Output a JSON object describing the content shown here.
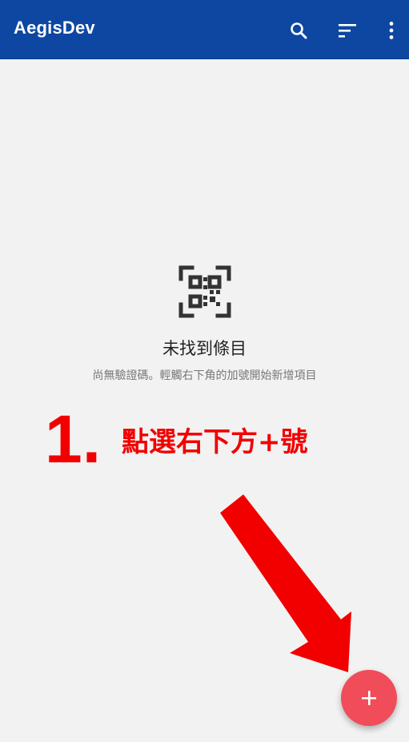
{
  "appbar": {
    "title": "AegisDev",
    "icons": [
      "search-icon",
      "sort-icon",
      "more-vertical-icon"
    ],
    "background": "#0d47a1"
  },
  "empty_state": {
    "icon": "qr-code-icon",
    "title": "未找到條目",
    "description": "尚無驗證碼。輕觸右下角的加號開始新增項目"
  },
  "annotation": {
    "step_number": "1.",
    "instruction": "點選右下方+號",
    "color": "#f20000",
    "arrow_icon": "red-arrow-icon"
  },
  "fab": {
    "icon": "plus-icon",
    "color": "#f04c5a"
  }
}
